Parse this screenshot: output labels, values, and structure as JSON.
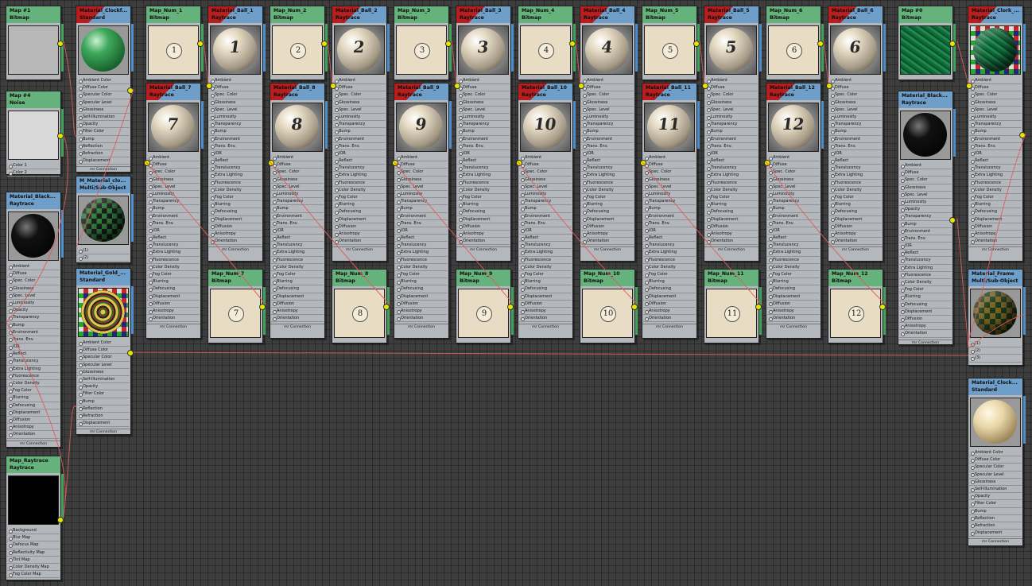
{
  "colors": {
    "canvas": "#3d3d3d",
    "map_header": "#66b27d",
    "material_header": "#6f9fc9",
    "selected_header": "#b81e1e",
    "socket": "#e6e600",
    "wire": "#e05a5a"
  },
  "std_slots": [
    "Ambient Color",
    "Diffuse Color",
    "Specular Color",
    "Specular Level",
    "Glossiness",
    "Self-Illumination",
    "Opacity",
    "Filter Color",
    "Bump",
    "Reflection",
    "Refraction",
    "Displacement"
  ],
  "rt_slots": [
    "Ambient",
    "Diffuse",
    "Spec. Color",
    "Glossiness",
    "Spec. Level",
    "Luminosity",
    "Transparency",
    "Bump",
    "Environment",
    "Trans. Env.",
    "IOR",
    "Reflect",
    "Translucency",
    "Extra Lighting",
    "Fluorescence",
    "Color Density",
    "Fog Color",
    "Blurring",
    "Defocusing",
    "Displacement",
    "Diffusion",
    "Anisotropy",
    "Orientation"
  ],
  "rt_slots_b": [
    "Ambient",
    "Diffuse",
    "Spec. Color",
    "Glossiness",
    "Spec. Level",
    "Luminosity",
    "Opacity",
    "Transparency",
    "Bump",
    "Environment",
    "Trans. Env.",
    "IOR",
    "Reflect",
    "Translucency",
    "Extra Lighting",
    "Fluorescence",
    "Color Density",
    "Fog Color",
    "Blurring",
    "Defocusing",
    "Displacement",
    "Diffusion",
    "Anisotropy",
    "Orientation"
  ],
  "rt_map_slots": [
    "Background",
    "Blur Map",
    "Defocus Map",
    "Reflectivity Map",
    "Tint Map",
    "Color Density Map",
    "Fog Color Map"
  ],
  "noise_slots": [
    "Color 1",
    "Color 2"
  ],
  "multi_slots": [
    "(1)",
    "(2)"
  ],
  "multi3_slots": [
    "(1)",
    "(2)",
    "(3)"
  ],
  "footer": "mr Connection",
  "nodes": {
    "map1": {
      "name": "Map #1",
      "type": "Bitmap"
    },
    "map4": {
      "name": "Map #4",
      "type": "Noise"
    },
    "mat_black_a": {
      "name": "Material_Black...",
      "type": "Raytrace"
    },
    "map_raytrace": {
      "name": "Map_Raytrace",
      "type": "Raytrace"
    },
    "mat_clockf": {
      "name": "Material_Clockf...",
      "type": "Standard"
    },
    "m_mat_clo": {
      "name": "M_Material_clo...",
      "type": "Multi/Sub-Object"
    },
    "mat_gold": {
      "name": "Material_Gold_...",
      "type": "Standard"
    },
    "map_num_1": {
      "name": "Map_Num_1",
      "type": "Bitmap",
      "num": "1"
    },
    "mat_ball_1": {
      "name": "Material_Ball_1",
      "type": "Raytrace",
      "num": "1"
    },
    "map_num_2": {
      "name": "Map_Num_2",
      "type": "Bitmap",
      "num": "2"
    },
    "mat_ball_2": {
      "name": "Material_Ball_2",
      "type": "Raytrace",
      "num": "2"
    },
    "map_num_3": {
      "name": "Map_Num_3",
      "type": "Bitmap",
      "num": "3"
    },
    "mat_ball_3": {
      "name": "Material_Ball_3",
      "type": "Raytrace",
      "num": "3"
    },
    "map_num_4": {
      "name": "Map_Num_4",
      "type": "Bitmap",
      "num": "4"
    },
    "mat_ball_4": {
      "name": "Material_Ball_4",
      "type": "Raytrace",
      "num": "4"
    },
    "map_num_5": {
      "name": "Map_Num_5",
      "type": "Bitmap",
      "num": "5"
    },
    "mat_ball_5": {
      "name": "Material_Ball_5",
      "type": "Raytrace",
      "num": "5"
    },
    "map_num_6": {
      "name": "Map_Num_6",
      "type": "Bitmap",
      "num": "6"
    },
    "mat_ball_6": {
      "name": "Material_Ball_6",
      "type": "Raytrace",
      "num": "6"
    },
    "map0": {
      "name": "Map #0",
      "type": "Bitmap"
    },
    "mat_clork": {
      "name": "Material_Clork_...",
      "type": "Raytrace"
    },
    "mat_ball_7": {
      "name": "Material_Ball_7",
      "type": "Raytrace",
      "num": "7"
    },
    "mat_ball_8": {
      "name": "Material_Ball_8",
      "type": "Raytrace",
      "num": "8"
    },
    "mat_ball_9": {
      "name": "Material_Ball_9",
      "type": "Raytrace",
      "num": "9"
    },
    "mat_ball_10": {
      "name": "Material_Ball_10",
      "type": "Raytrace",
      "num": "10"
    },
    "mat_ball_11": {
      "name": "Material_Ball_11",
      "type": "Raytrace",
      "num": "11"
    },
    "mat_ball_12": {
      "name": "Material_Ball_12",
      "type": "Raytrace",
      "num": "12"
    },
    "mat_black_b": {
      "name": "Material_Black...",
      "type": "Raytrace"
    },
    "map_num_7": {
      "name": "Map_Num_7",
      "type": "Bitmap",
      "num": "7"
    },
    "map_num_8": {
      "name": "Map_Num_8",
      "type": "Bitmap",
      "num": "8"
    },
    "map_num_9": {
      "name": "Map_Num_9",
      "type": "Bitmap",
      "num": "9"
    },
    "map_num_10": {
      "name": "Map_Num_10",
      "type": "Bitmap",
      "num": "10"
    },
    "map_num_11": {
      "name": "Map_Num_11",
      "type": "Bitmap",
      "num": "11"
    },
    "map_num_12": {
      "name": "Map_Num_12",
      "type": "Bitmap",
      "num": "12"
    },
    "mat_frame": {
      "name": "Material_Frame",
      "type": "Multi/Sub-Object"
    },
    "mat_clock_std": {
      "name": "Material_Clock...",
      "type": "Standard"
    }
  }
}
